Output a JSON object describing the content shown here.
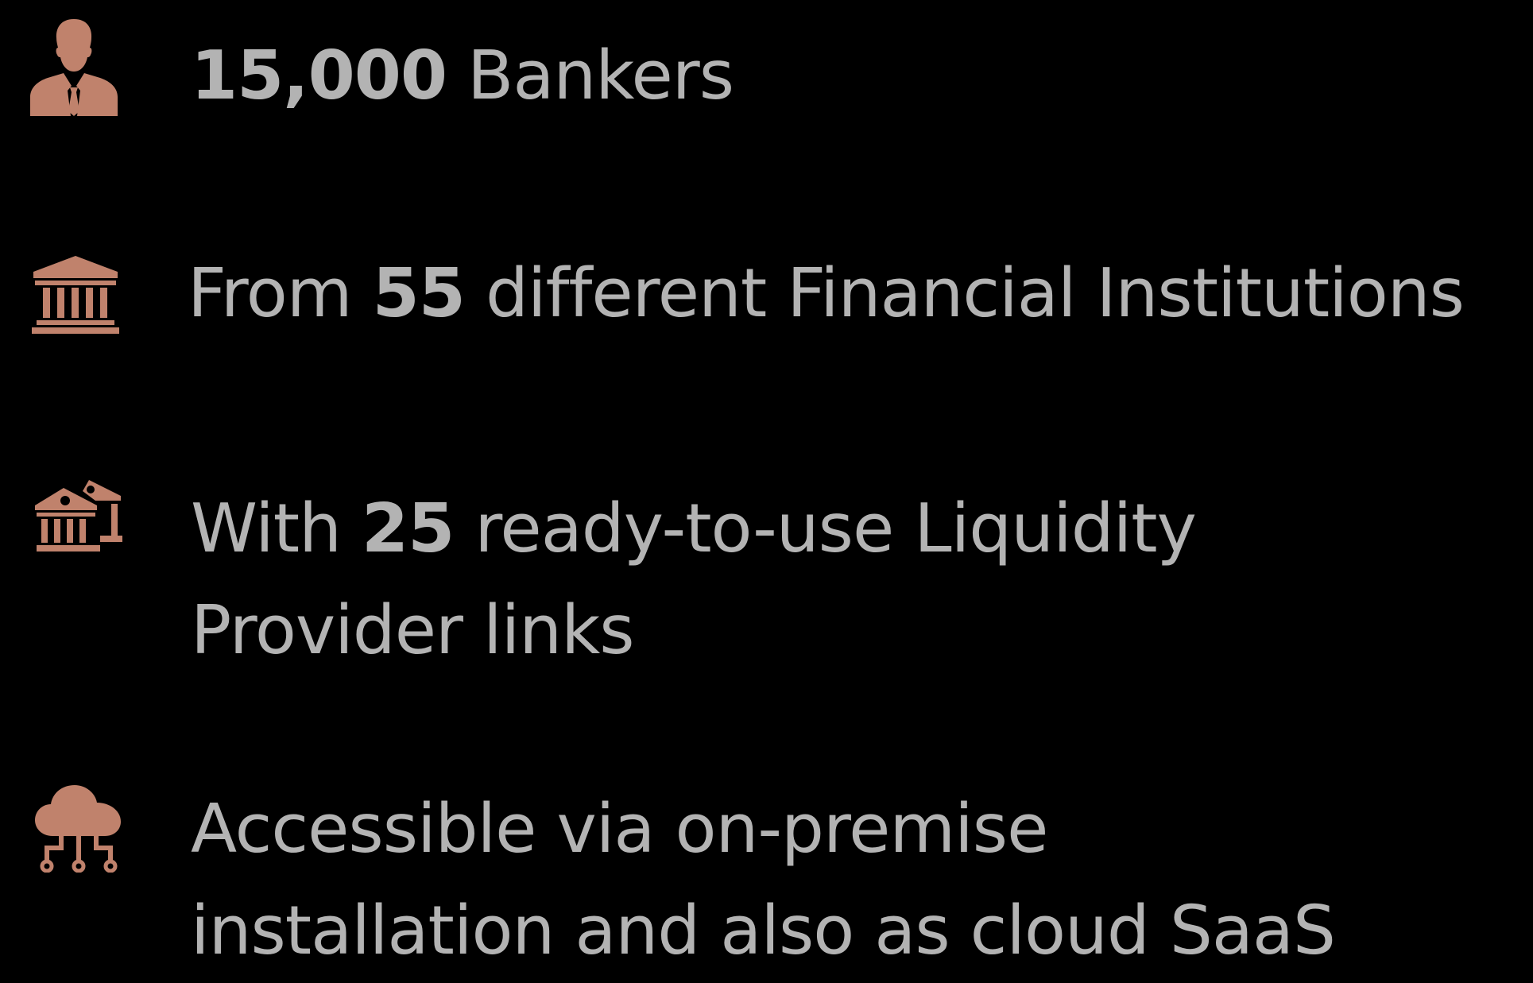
{
  "theme": {
    "background": "#000000",
    "text_color": "#b3b3b3",
    "icon_color": "#c0826c"
  },
  "stats": [
    {
      "icon": "banker-icon",
      "bold": "15,000",
      "text_after": " Bankers"
    },
    {
      "icon": "bank-icon",
      "text_before": "From ",
      "bold": "55",
      "text_after": " different Financial Institutions"
    },
    {
      "icon": "banks-network-icon",
      "text_before": "With ",
      "bold": "25",
      "text_after": " ready-to-use Liquidity",
      "line2": "Provider links"
    },
    {
      "icon": "cloud-network-icon",
      "line1": "Accessible via on-premise",
      "line2": "installation and also as cloud SaaS"
    }
  ]
}
